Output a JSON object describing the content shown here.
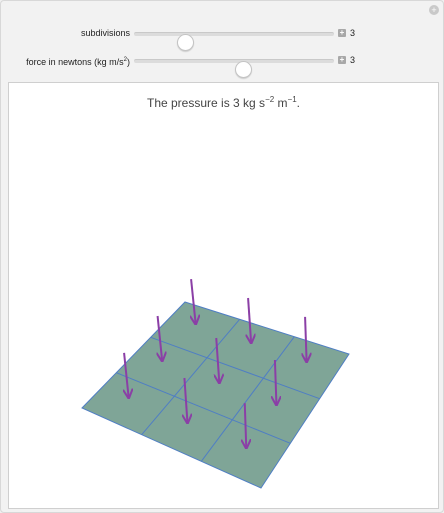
{
  "controls": [
    {
      "label": "subdivisions",
      "value": "3",
      "fraction": 0.25
    },
    {
      "label_main": "force in newtons (kg m/s",
      "label_sup": "2",
      "label_close": ")",
      "value": "3",
      "fraction": 0.55
    }
  ],
  "output": {
    "pressure_prefix": "The pressure is 3 kg s",
    "s_exp": "−2",
    "m_text": " m",
    "m_exp": "−1",
    "suffix": "."
  },
  "scene": {
    "plate_color": "#7fa597",
    "grid_color": "#4f7ec4",
    "arrow_color": "#8b3fa6",
    "subdivisions": 3,
    "arrow_count": 9
  },
  "icons": {
    "corner": "plus-icon"
  }
}
